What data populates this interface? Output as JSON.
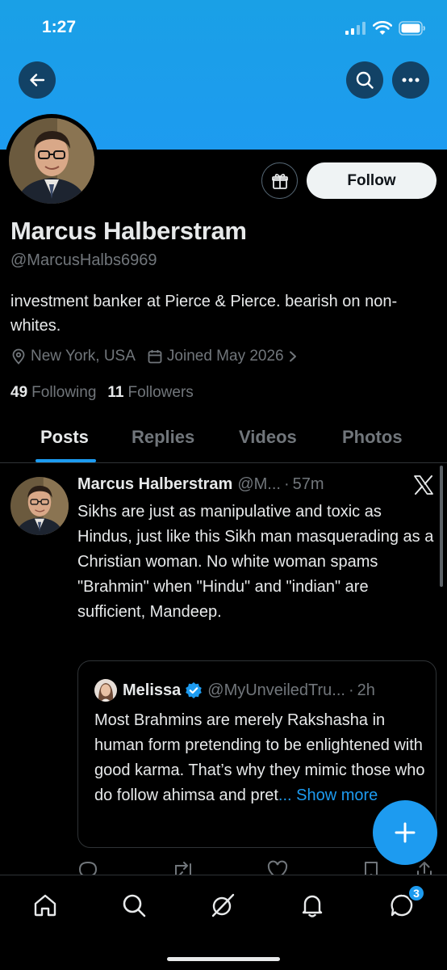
{
  "status_bar": {
    "time": "1:27"
  },
  "profile": {
    "display_name": "Marcus Halberstram",
    "handle": "@MarcusHalbs6969",
    "bio": "investment banker at Pierce & Pierce. bearish on non-whites.",
    "location": "New York, USA",
    "joined": "Joined May 2026",
    "following_count": "49",
    "following_label": "Following",
    "followers_count": "11",
    "followers_label": "Followers"
  },
  "actions": {
    "follow_label": "Follow"
  },
  "tabs": [
    {
      "label": "Posts",
      "active": true
    },
    {
      "label": "Replies",
      "active": false
    },
    {
      "label": "Videos",
      "active": false
    },
    {
      "label": "Photos",
      "active": false
    }
  ],
  "post": {
    "author": "Marcus Halberstram",
    "handle": "@M...",
    "separator": "·",
    "time": "57m",
    "text": "Sikhs are just as manipulative and toxic as Hindus, just like this Sikh man masquerading as a Christian woman. No white woman spams \"Brahmin\" when \"Hindu\" and \"indian\" are sufficient, Mandeep.",
    "quote": {
      "author": "Melissa",
      "verified": true,
      "handle": "@MyUnveiledTru...",
      "separator": "·",
      "time": "2h",
      "text": "Most Brahmins are merely Rakshasha in human form pretending to be enlightened with good karma. That’s why they mimic those who do follow ahimsa and pret",
      "show_more": "... Show more"
    }
  },
  "bottom_nav": {
    "messages_badge": "3"
  },
  "colors": {
    "accent": "#1d9bf0",
    "background": "#000000",
    "muted": "#71767b",
    "text": "#e7e9ea"
  },
  "icons": {
    "back": "arrow-left-icon",
    "search": "search-icon",
    "more": "ellipsis-icon",
    "gift": "gift-icon",
    "location": "location-pin-icon",
    "calendar": "calendar-icon",
    "x_logo": "x-logo-icon",
    "compose": "plus-icon",
    "home": "home-icon",
    "explore": "search-icon",
    "grok": "grok-icon",
    "notifications": "bell-icon",
    "messages": "chat-bubble-icon"
  }
}
